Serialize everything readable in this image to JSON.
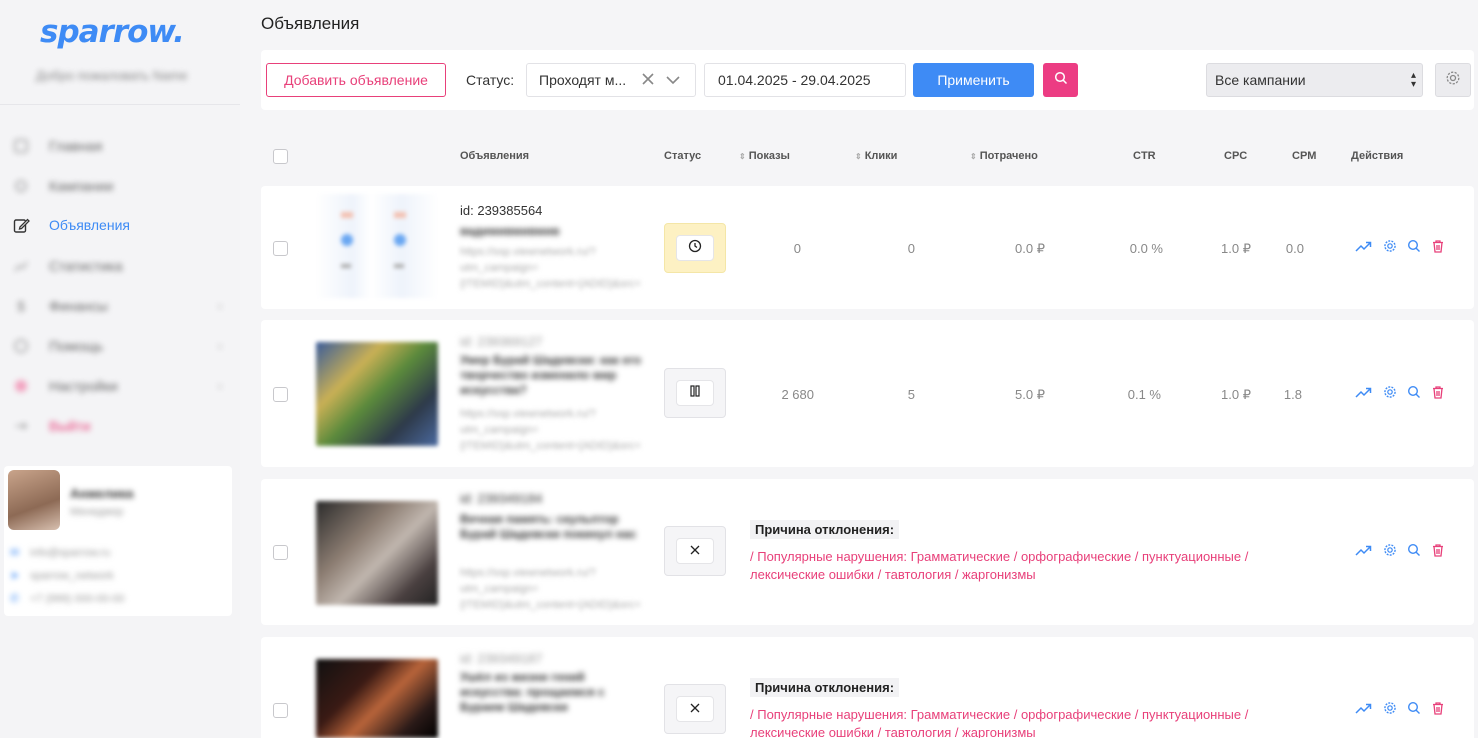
{
  "app": {
    "logo": "sparrow."
  },
  "sidebar": {
    "welcome": "Добро пожаловать Name",
    "items": [
      {
        "label": "Главная",
        "icon": "home-icon"
      },
      {
        "label": "Кампании",
        "icon": "campaign-icon"
      },
      {
        "label": "Объявления",
        "icon": "edit-icon",
        "active": true
      },
      {
        "label": "Статистика",
        "icon": "chart-icon"
      },
      {
        "label": "Финансы",
        "icon": "money-icon"
      },
      {
        "label": "Помощь",
        "icon": "help-icon"
      },
      {
        "label": "Настройки",
        "icon": "settings-icon"
      },
      {
        "label": "Выйти",
        "icon": "logout-icon"
      }
    ],
    "user": {
      "name": "Анжелика",
      "role": "Менеджер",
      "email": "info@sparrow.ru",
      "telegram": "sparrow_network",
      "phone": "+7 (999) 000-00-00"
    }
  },
  "page": {
    "title": "Объявления"
  },
  "toolbar": {
    "add_label": "Добавить объявление",
    "status_label": "Статус:",
    "status_value": "Проходят м...",
    "date_range": "01.04.2025 - 29.04.2025",
    "apply_label": "Применить",
    "campaign_value": "Все кампании"
  },
  "table": {
    "headers": {
      "ads": "Объявления",
      "status": "Статус",
      "impressions": "Показы",
      "clicks": "Клики",
      "spent": "Потрачено",
      "ctr": "CTR",
      "cpc": "CPC",
      "cpm": "CPM",
      "actions": "Действия"
    },
    "rows": [
      {
        "id": "id: 239385564",
        "title": "вадимивмивмив",
        "link": "https://ssp.viewnetwork.ru/?utm_campaign={ITEMID}&utm_content={ADID}&src={SITE_ID}",
        "status": "pending",
        "impressions": "0",
        "clicks": "0",
        "spent": "0.0 ₽",
        "ctr": "0.0 %",
        "cpc": "1.0 ₽",
        "cpm": "0.0"
      },
      {
        "id": "id: 239369127",
        "title": "Умер Бурай Шадевски: как его творчество изменило мир искусства?",
        "link": "https://ssp.viewnetwork.ru/?utm_campaign={ITEMID}&utm_content={ADID}&src={SITE_ID}",
        "status": "paused",
        "impressions": "2 680",
        "clicks": "5",
        "spent": "5.0 ₽",
        "ctr": "0.1 %",
        "cpc": "1.0 ₽",
        "cpm": "1.8"
      },
      {
        "id": "id: 239349184",
        "title": "Вечная память: скульптор Бурай Шадевски покинул нас",
        "link": "https://ssp.viewnetwork.ru/?utm_campaign={ITEMID}&utm_content={ADID}&src={SITE_ID}",
        "status": "rejected",
        "reason_title": "Причина отклонения:",
        "reason": "/ Популярные нарушения: Грамматические / орфографические / пунктуационные / лексические ошибки / тавтология / жаргонизмы"
      },
      {
        "id": "id: 239349187",
        "title": "Ушёл из жизни гений искусства: прощаемся с Бураем Шадевски",
        "link": "https://ssp.viewnetwork.ru/?utm_campaign={ITEMID}&utm_content={ADID}&src={SITE_ID}",
        "status": "rejected",
        "reason_title": "Причина отклонения:",
        "reason": "/ Популярные нарушения: Грамматические / орфографические / пунктуационные / лексические ошибки / тавтология / жаргонизмы"
      }
    ]
  },
  "colors": {
    "accent": "#3e8bf5",
    "danger": "#e8407a",
    "pink_button": "#ec3c83"
  }
}
